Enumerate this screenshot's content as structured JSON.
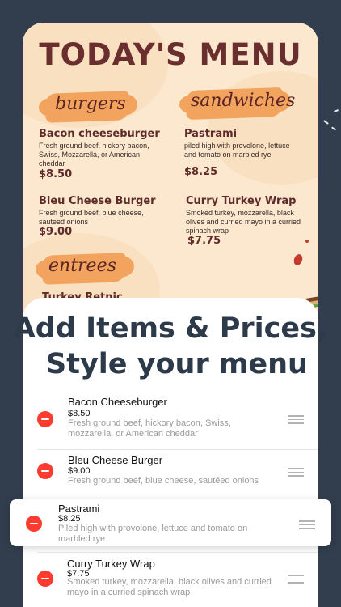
{
  "menu_preview": {
    "title": "TODAY'S MENU",
    "sections": {
      "burgers": "burgers",
      "sandwiches": "sandwiches",
      "entrees": "entrees"
    },
    "items": [
      {
        "name": "Bacon cheeseburger",
        "desc": "Fresh ground beef, hickory bacon, Swiss, Mozzarella, or American cheddar",
        "price": "$8.50"
      },
      {
        "name": "Bleu Cheese Burger",
        "desc": "Fresh ground beef, blue cheese, sauteed onions",
        "price": "$9.00"
      },
      {
        "name": "Pastrami",
        "desc": "piled high with provolone, lettuce and tomato on marbled rye",
        "price": "$8.25"
      },
      {
        "name": "Curry Turkey Wrap",
        "desc": "Smoked turkey, mozzarella, black olives and curried mayo in a curried spinach wrap",
        "price": "$7.75"
      },
      {
        "name": "Turkey Retnic"
      }
    ]
  },
  "headline": {
    "line1": "Add Items & Prices,",
    "line2": "Style your menu"
  },
  "list": [
    {
      "name": "Bacon Cheeseburger",
      "price": "$8.50",
      "desc": "Fresh ground beef, hickory bacon, Swiss, mozzarella, or American cheddar"
    },
    {
      "name": "Bleu Cheese Burger",
      "price": "$9.00",
      "desc": "Fresh ground beef, blue cheese, sautéed onions"
    },
    {
      "name": "Pastrami",
      "price": "$8.25",
      "desc": "Piled high with provolone, lettuce and tomato on marbled rye"
    },
    {
      "name": "Curry Turkey Wrap",
      "price": "$7.75",
      "desc": "Smoked turkey, mozzarella, black olives and curried mayo in a curried spinach wrap"
    }
  ],
  "colors": {
    "background": "#323e4e",
    "menu_paper": "#fbe8cf",
    "menu_text": "#6a2e2e",
    "brush_accent": "#f2a35e",
    "delete": "#ff3b30"
  },
  "icons": [
    "delete-icon",
    "drag-handle-icon"
  ]
}
